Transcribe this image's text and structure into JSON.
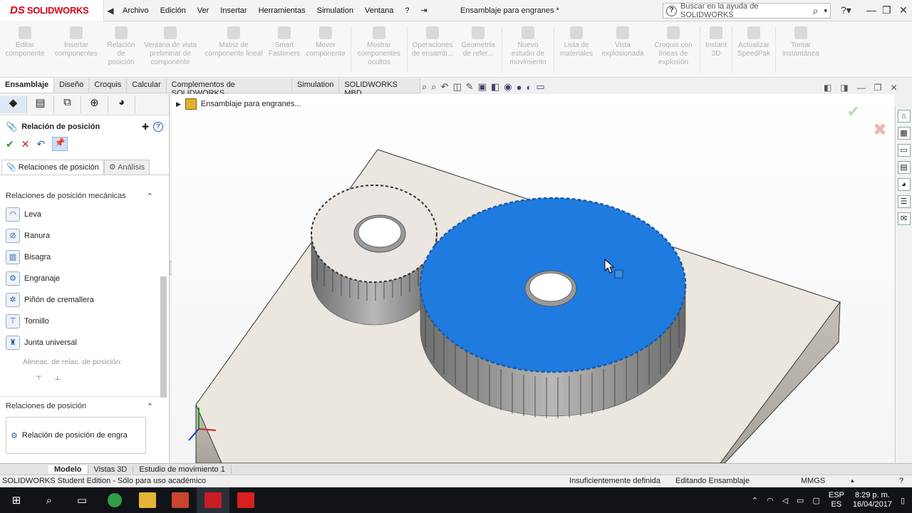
{
  "app": {
    "logo_ds": "DS",
    "logo_name": "SOLIDWORKS",
    "doc_title": "Ensamblaje para engranes *",
    "help_placeholder": "Buscar en la ayuda de SOLIDWORKS",
    "accent": "#d4001a"
  },
  "menu": [
    "Archivo",
    "Edición",
    "Ver",
    "Insertar",
    "Herramientas",
    "Simulation",
    "Ventana",
    "?"
  ],
  "commands": [
    {
      "label": "Editar\ncomponente"
    },
    {
      "label": "Insertar\ncomponentes"
    },
    {
      "label": "Relación\nde\nposición"
    },
    {
      "label": "Ventana de vista\npreliminar de\ncomponente"
    },
    {
      "label": "Matriz de\ncomponente lineal"
    },
    {
      "label": "Smart\nFasteners"
    },
    {
      "label": "Mover\ncomponente"
    },
    {
      "label": "Mostrar\ncomponentes\nocultos"
    },
    {
      "label": "Operaciones\nde ensamb..."
    },
    {
      "label": "Geometría\nde refer..."
    },
    {
      "label": "Nuevo\nestudio de\nmovimiento"
    },
    {
      "label": "Lista de\nmateriales"
    },
    {
      "label": "Vista\nexplosionada"
    },
    {
      "label": "Croquis con\nlíneas de\nexplosión"
    },
    {
      "label": "Instant\n3D"
    },
    {
      "label": "Actualizar\nSpeedPak"
    },
    {
      "label": "Tomar\ninstantánea"
    }
  ],
  "tabs": [
    "Ensamblaje",
    "Diseño",
    "Croquis",
    "Calcular",
    "Complementos de SOLIDWORKS",
    "Simulation",
    "SOLIDWORKS MBD"
  ],
  "pm": {
    "title": "Relación de posición",
    "subtab_active": "Relaciones de posición",
    "subtab_inactive": "Análisis",
    "section_mech": "Relaciones de posición mecánicas",
    "mates": [
      "Leva",
      "Ranura",
      "Bisagra",
      "Engranaje",
      "Piñón de cremallera",
      "Tornillo",
      "Junta universal"
    ],
    "align_label": "Alineac. de relac. de posición:",
    "section_mates": "Relaciones de posición",
    "mate_entry": "Relación de posición de engra"
  },
  "graphics": {
    "tree_label": "Ensamblaje para engranes...",
    "plate_color": "#ebe7de",
    "gear_large_color": "#1f7be0",
    "gear_small_color": "#ece6e3"
  },
  "bottom_tabs": [
    "Modelo",
    "Vistas 3D",
    "Estudio de movimiento 1"
  ],
  "status": {
    "edition": "SOLIDWORKS Student Edition - Sólo para uso académico",
    "definition": "Insuficientemente definida",
    "editing": "Editando Ensamblaje",
    "units": "MMGS"
  },
  "taskbar": {
    "lang_top": "ESP",
    "lang_bottom": "ES",
    "time": "8:29 p. m.",
    "date": "16/04/2017"
  }
}
